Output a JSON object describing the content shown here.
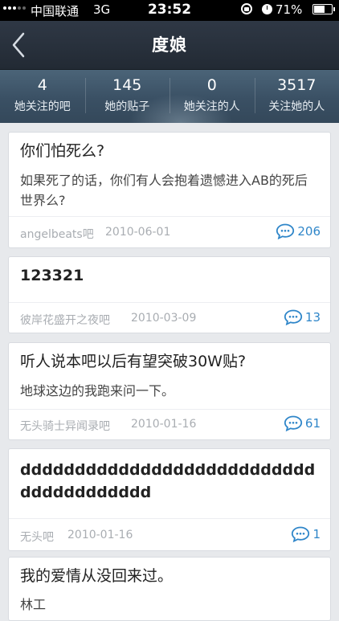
{
  "status_bar": {
    "carrier": "中国联通",
    "network": "3G",
    "time": "23:52",
    "battery": "71%",
    "battery_level": 0.71
  },
  "header": {
    "title": "度娘"
  },
  "stats": [
    {
      "value": "4",
      "label": "她关注的吧"
    },
    {
      "value": "145",
      "label": "她的贴子"
    },
    {
      "value": "0",
      "label": "她关注的人"
    },
    {
      "value": "3517",
      "label": "关注她的人"
    }
  ],
  "posts": [
    {
      "title": "你们怕死么?",
      "body": "如果死了的话，你们有人会抱着遗憾进入AB的死后世界么?",
      "forum": "angelbeats吧",
      "date": "2010-06-01",
      "replies": "206"
    },
    {
      "title": "123321",
      "body": "",
      "forum": "彼岸花盛开之夜吧",
      "date": "2010-03-09",
      "replies": "13"
    },
    {
      "title": "听人说本吧以后有望突破30W贴?",
      "body": "地球这边的我跑来问一下。",
      "forum": "无头骑士异闻录吧",
      "date": "2010-01-16",
      "replies": "61"
    },
    {
      "title": "ddddddddddddddddddddddddddddddddddddddd",
      "body": "",
      "forum": "无头吧",
      "date": "2010-01-16",
      "replies": "1"
    },
    {
      "title": "我的爱情从没回来过。",
      "body": "林工",
      "forum": "",
      "date": "",
      "replies": ""
    }
  ],
  "colors": {
    "accent": "#2f86c9",
    "header_bg": "#2a323d",
    "stats_bg": "#3d5468",
    "page_bg": "#e7e9ec"
  },
  "icons": {
    "back": "chevron-left-icon",
    "reply": "comment-bubble-icon"
  }
}
